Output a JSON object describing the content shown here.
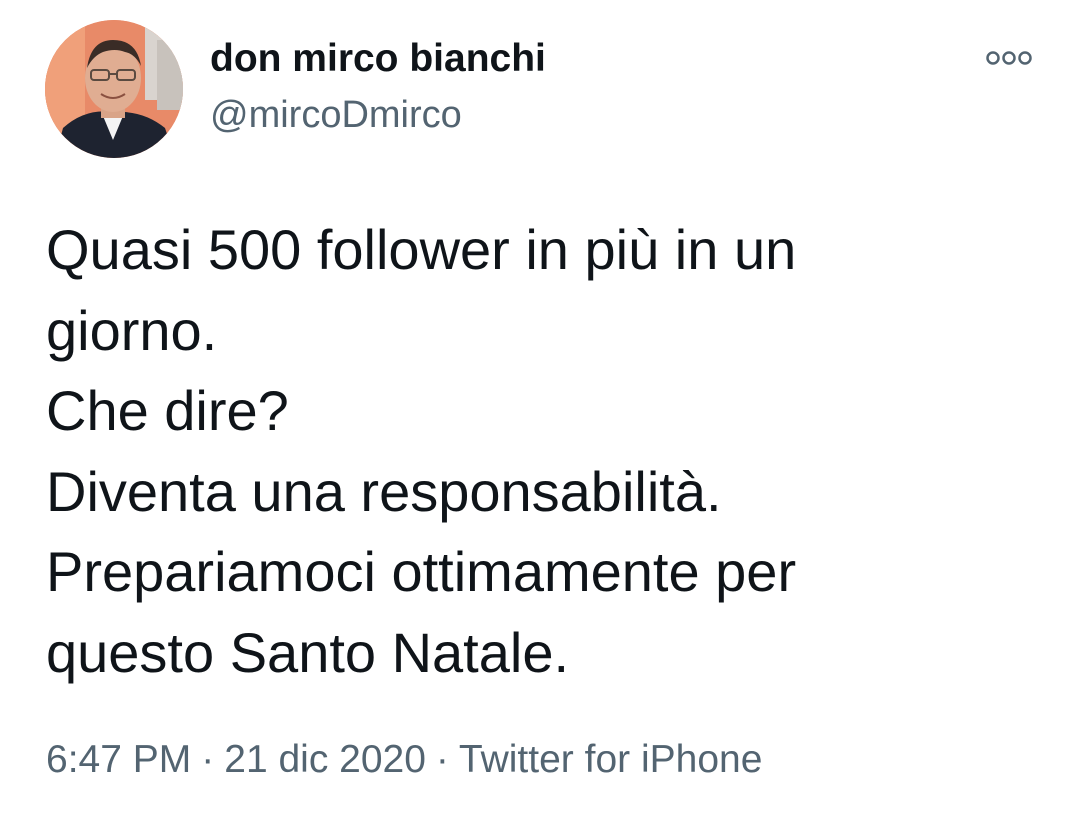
{
  "author": {
    "display_name": "don mirco bianchi",
    "handle": "@mircoDmirco",
    "avatar_icon": "profile-photo"
  },
  "more_icon": "more-horizontal-icon",
  "tweet": {
    "lines": [
      "Quasi 500 follower in più in un",
      "giorno.",
      "Che dire?",
      "Diventa una responsabilità.",
      "Prepariamoci ottimamente per",
      "questo Santo Natale."
    ]
  },
  "meta": {
    "time": "6:47 PM",
    "separator": "·",
    "date": "21 dic 2020",
    "source": "Twitter for iPhone"
  },
  "colors": {
    "text": "#0f1419",
    "secondary": "#536471",
    "background": "#ffffff"
  }
}
